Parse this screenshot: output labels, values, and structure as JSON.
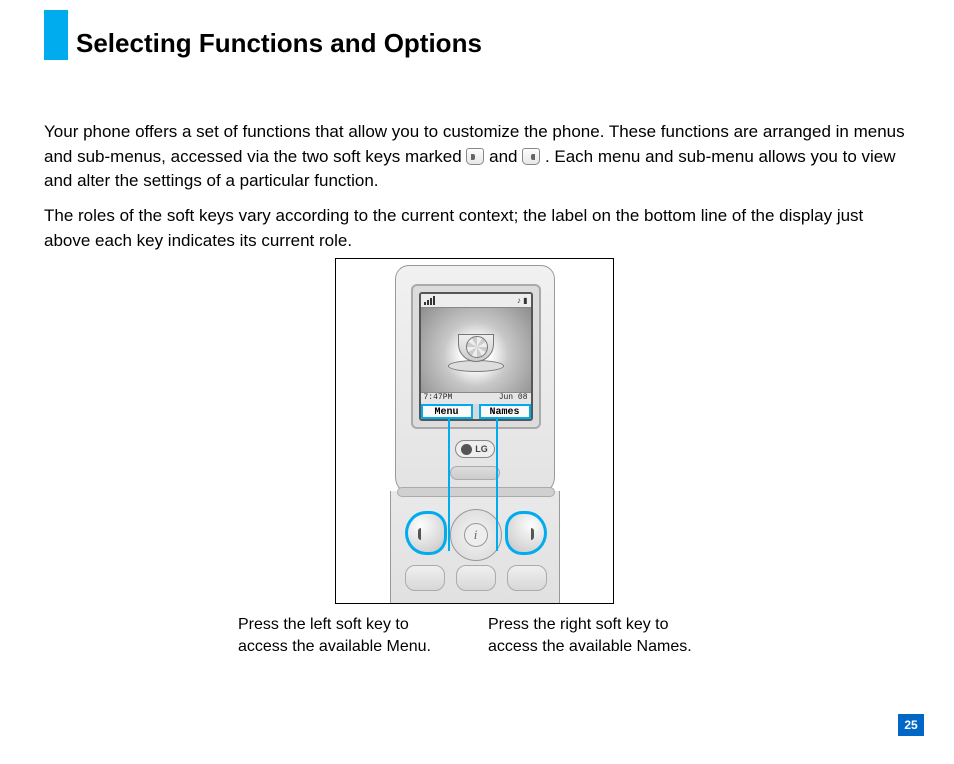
{
  "title": "Selecting Functions and Options",
  "paragraphs": {
    "p1a": "Your phone offers a set of functions that allow you to customize the phone. These functions are arranged in menus and sub-menus, accessed via the two soft keys marked ",
    "p1b": " and ",
    "p1c": " . Each menu and sub-menu allows you to view and alter the settings of a particular function.",
    "p2": "The roles of the soft keys vary according to the current context; the label on the bottom line of the display just above each key indicates its current role."
  },
  "phone": {
    "status_signal_text": "T.ıl",
    "wallpaper_alt": "cup-with-lemon",
    "time_left": "7:47PM",
    "time_right": "Jun 08",
    "softkey_left_label": "Menu",
    "softkey_right_label": "Names",
    "brand": "LG",
    "nav_center_glyph": "i"
  },
  "captions": {
    "left": "Press the left soft key to access the available Menu.",
    "right": "Press the right soft key to access the available Names."
  },
  "page_number": "25"
}
